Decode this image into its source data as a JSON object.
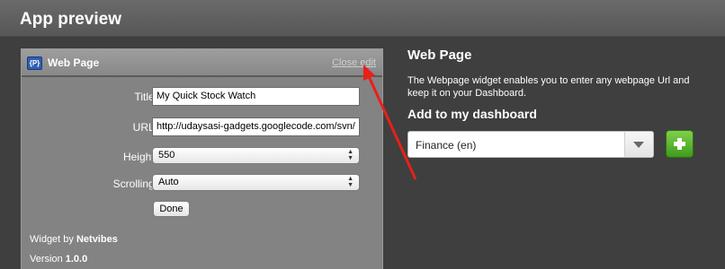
{
  "header": {
    "title": "App preview"
  },
  "widget": {
    "icon_label": "{P}",
    "title": "Web Page",
    "close_edit": "Close edit",
    "fields": {
      "title_label": "Title:",
      "title_value": "My Quick Stock Watch",
      "url_label": "URL:",
      "url_value": "http://udaysasi-gadgets.googlecode.com/svn/",
      "height_label": "Height:",
      "height_value": "550",
      "scrolling_label": "Scrolling:",
      "scrolling_value": "Auto"
    },
    "done_label": "Done",
    "widget_by_prefix": "Widget by ",
    "widget_by_name": "Netvibes",
    "version_prefix": "Version ",
    "version_value": "1.0.0"
  },
  "info": {
    "title": "Web Page",
    "description": "The Webpage widget enables you to enter any webpage Url and keep it on your Dashboard.",
    "add_title": "Add to my dashboard",
    "dashboard_selected": "Finance (en)"
  },
  "colors": {
    "background": "#3f3f3f",
    "add_button": "#4caf26",
    "annotation_arrow": "#e8201a"
  },
  "icons": {
    "select_arrows": "updown-arrows-icon",
    "dropdown": "chevron-down-icon",
    "add": "plus-icon"
  }
}
